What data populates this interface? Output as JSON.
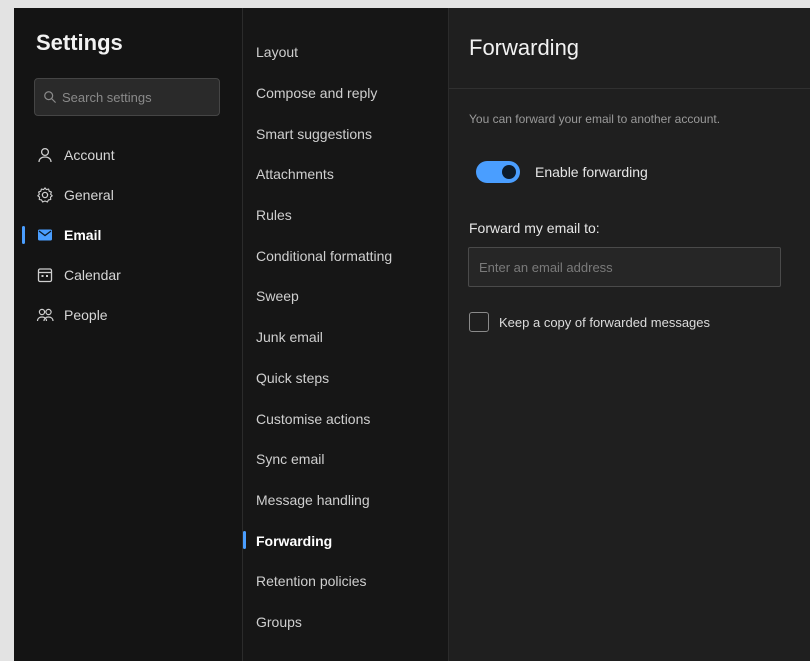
{
  "nav": {
    "title": "Settings",
    "search_placeholder": "Search settings",
    "items": [
      {
        "label": "Account",
        "icon": "person-icon"
      },
      {
        "label": "General",
        "icon": "gear-icon"
      },
      {
        "label": "Email",
        "icon": "mail-icon",
        "active": true
      },
      {
        "label": "Calendar",
        "icon": "calendar-icon"
      },
      {
        "label": "People",
        "icon": "people-icon"
      }
    ]
  },
  "submenu": {
    "items": [
      "Layout",
      "Compose and reply",
      "Smart suggestions",
      "Attachments",
      "Rules",
      "Conditional formatting",
      "Sweep",
      "Junk email",
      "Quick steps",
      "Customise actions",
      "Sync email",
      "Message handling",
      "Forwarding",
      "Retention policies",
      "Groups"
    ],
    "active": "Forwarding"
  },
  "content": {
    "title": "Forwarding",
    "description": "You can forward your email to another account.",
    "toggle_label": "Enable forwarding",
    "toggle_on": true,
    "forward_label": "Forward my email to:",
    "email_placeholder": "Enter an email address",
    "email_value": "",
    "keep_copy_label": "Keep a copy of forwarded messages",
    "keep_copy_checked": false
  },
  "colors": {
    "accent": "#4a9eff",
    "background": "#1f1f1f",
    "nav_background": "#141414"
  }
}
